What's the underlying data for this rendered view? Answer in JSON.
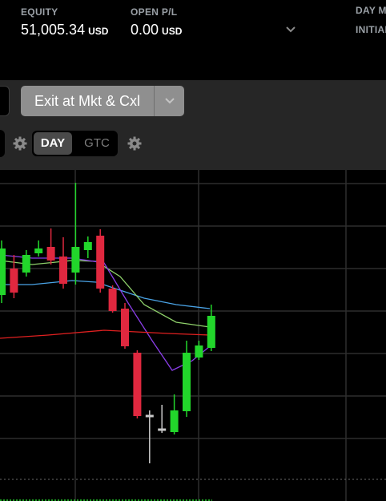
{
  "header": {
    "equity": {
      "label": "EQUITY",
      "value": "51,005.34",
      "unit": "USD"
    },
    "open_pl": {
      "label": "OPEN P/L",
      "value": "0.00",
      "unit": "USD"
    },
    "day": {
      "label": "DAY M",
      "sub": "INITIAL"
    },
    "expand_icon": "chevron-down-icon"
  },
  "toolbar": {
    "exit_label": "Exit at Mkt & Cxl",
    "exit_dropdown_icon": "chevron-down-icon",
    "settings_icon": "gear-icon",
    "time_in_force": {
      "options": [
        "DAY",
        "GTC"
      ],
      "selected": "DAY"
    }
  },
  "colors": {
    "up": "#22d62b",
    "down": "#e0283f",
    "wick": "#c8c8c8",
    "ma_blue": "#4aa3e6",
    "ma_green": "#8fd16b",
    "ma_purple": "#8a3ee8",
    "ma_red": "#e02020",
    "grid": "#2e2e2e",
    "panel": "#262626",
    "button": "#8f8f8f"
  },
  "chart_data": {
    "type": "candlestick",
    "y_axis_labels": "not visible",
    "candles": [
      {
        "o": 368,
        "h": 300,
        "l": 378,
        "c": 310
      },
      {
        "o": 335,
        "h": 318,
        "l": 372,
        "c": 365
      },
      {
        "o": 340,
        "h": 312,
        "l": 345,
        "c": 318
      },
      {
        "o": 316,
        "h": 300,
        "l": 320,
        "c": 310
      },
      {
        "o": 308,
        "h": 285,
        "l": 330,
        "c": 325
      },
      {
        "o": 320,
        "h": 296,
        "l": 360,
        "c": 354
      },
      {
        "o": 340,
        "h": 228,
        "l": 355,
        "c": 308
      },
      {
        "o": 312,
        "h": 295,
        "l": 322,
        "c": 302
      },
      {
        "o": 294,
        "h": 286,
        "l": 365,
        "c": 360
      },
      {
        "o": 360,
        "h": 356,
        "l": 390,
        "c": 388
      },
      {
        "o": 385,
        "h": 378,
        "l": 435,
        "c": 432
      },
      {
        "o": 440,
        "h": 437,
        "l": 522,
        "c": 519
      },
      {
        "o": 519,
        "h": 512,
        "l": 578,
        "c": 517
      },
      {
        "o": 536,
        "h": 505,
        "l": 540,
        "c": 533
      },
      {
        "o": 539,
        "h": 492,
        "l": 542,
        "c": 512
      },
      {
        "o": 513,
        "h": 425,
        "l": 520,
        "c": 440
      },
      {
        "o": 446,
        "h": 425,
        "l": 449,
        "c": 431
      },
      {
        "o": 434,
        "h": 380,
        "l": 438,
        "c": 394
      }
    ],
    "moving_averages": [
      {
        "color_key": "ma_blue",
        "points": [
          [
            0,
            355
          ],
          [
            40,
            355
          ],
          [
            90,
            350
          ],
          [
            120,
            352
          ],
          [
            150,
            362
          ],
          [
            180,
            372
          ],
          [
            220,
            380
          ],
          [
            262,
            385
          ]
        ]
      },
      {
        "color_key": "ma_green",
        "points": [
          [
            0,
            325
          ],
          [
            40,
            330
          ],
          [
            90,
            325
          ],
          [
            120,
            326
          ],
          [
            150,
            345
          ],
          [
            180,
            380
          ],
          [
            220,
            402
          ],
          [
            262,
            408
          ]
        ]
      },
      {
        "color_key": "ma_purple",
        "points": [
          [
            0,
            318
          ],
          [
            40,
            322
          ],
          [
            90,
            322
          ],
          [
            130,
            328
          ],
          [
            160,
            378
          ],
          [
            190,
            425
          ],
          [
            215,
            462
          ],
          [
            240,
            450
          ],
          [
            262,
            432
          ]
        ]
      },
      {
        "color_key": "ma_red",
        "points": [
          [
            0,
            422
          ],
          [
            60,
            418
          ],
          [
            130,
            412
          ],
          [
            170,
            414
          ],
          [
            210,
            416
          ],
          [
            262,
            418
          ]
        ]
      }
    ]
  }
}
